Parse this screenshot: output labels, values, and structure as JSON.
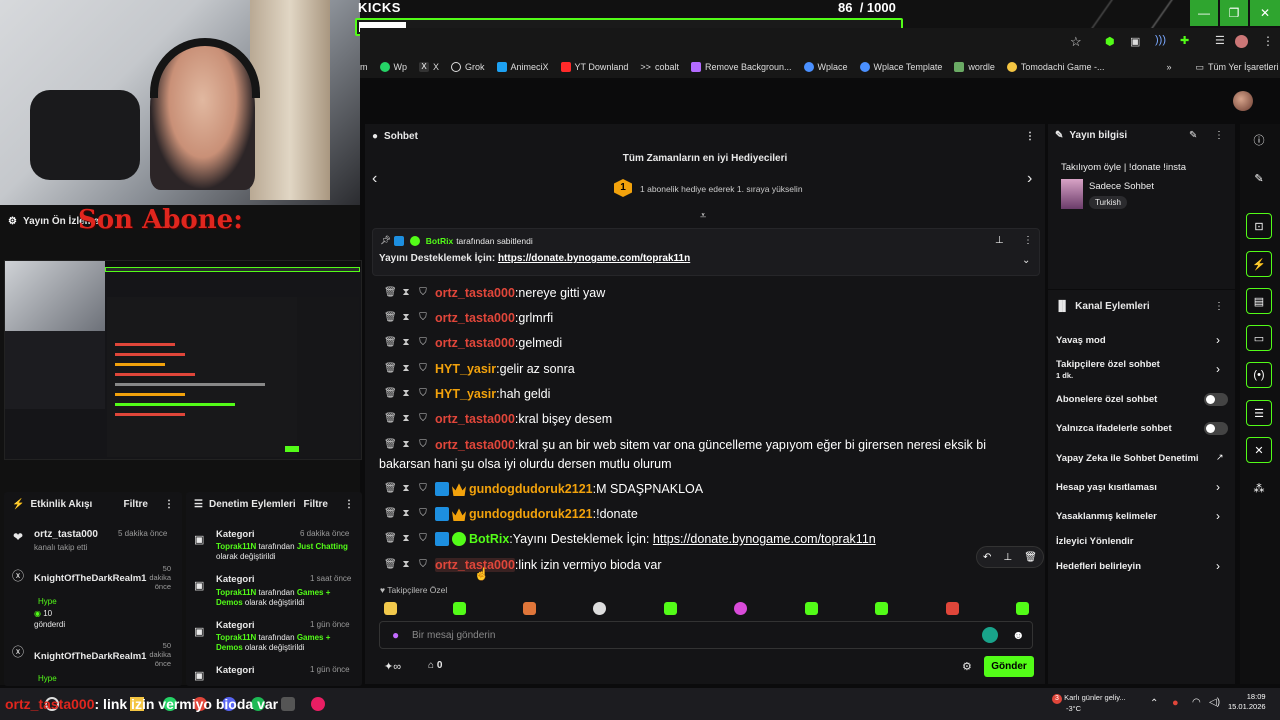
{
  "browser": {
    "goal_title": "KICKS",
    "goal_count": "86",
    "goal_total": "/ 1000",
    "goal_progress": 0.086,
    "bookmarks": [
      {
        "label": "Wp",
        "icon": "whatsapp-icon",
        "color": "#25d366"
      },
      {
        "label": "X",
        "icon": "x-icon",
        "color": "#ffffff"
      },
      {
        "label": "Grok",
        "icon": "grok-icon",
        "color": "#dddddd"
      },
      {
        "label": "AnimeciX",
        "icon": "animecix-icon",
        "color": "#1da1f2"
      },
      {
        "label": "YT Downland",
        "icon": "youtube-icon",
        "color": "#ff2a2a"
      },
      {
        "label": "cobalt",
        "icon": "cobalt-icon",
        "color": "#dddddd"
      },
      {
        "label": "Remove Backgroun...",
        "icon": "removebg-icon",
        "color": "#b36bff"
      },
      {
        "label": "Wplace",
        "icon": "wplace-icon",
        "color": "#4a90ff"
      },
      {
        "label": "Wplace Template",
        "icon": "wplace-template-icon",
        "color": "#4a90ff"
      },
      {
        "label": "wordle",
        "icon": "wordle-icon",
        "color": "#6aaa64"
      },
      {
        "label": "Tomodachi Game -...",
        "icon": "tomodachi-icon",
        "color": "#f4c542"
      }
    ],
    "all_bookmarks": "Tüm Yer İşaretleri"
  },
  "overlay": {
    "preview_title": "Yayın Ön İzleme",
    "son_abone": "Son Abone:",
    "activity": {
      "title": "Etkinlik Akışı",
      "filter": "Filtre",
      "items": [
        {
          "user": "ortz_tasta000",
          "detail": "kanalı takip etti",
          "time": "5 dakika önce"
        },
        {
          "user": "KnightOfTheDarkRealm1",
          "detail": "Hype",
          "amount": "10",
          "extra": "gönderdi",
          "time": "50 dakika önce"
        },
        {
          "user": "KnightOfTheDarkRealm1",
          "detail": "Hype",
          "time": "50 dakika önce"
        }
      ]
    },
    "moderation": {
      "title": "Denetim Eylemleri",
      "filter": "Filtre",
      "items": [
        {
          "label": "Kategori",
          "time": "6 dakika önce",
          "user": "Toprak11N",
          "mid": "tarafından",
          "value": "Just Chatting",
          "tail": "olarak değiştirildi"
        },
        {
          "label": "Kategori",
          "time": "1 saat önce",
          "user": "Toprak11N",
          "mid": "tarafından",
          "value": "Games + Demos",
          "tail": "olarak değiştirildi"
        },
        {
          "label": "Kategori",
          "time": "1 gün önce",
          "user": "Toprak11N",
          "mid": "tarafından",
          "value": "Games + Demos",
          "tail": "olarak değiştirildi"
        },
        {
          "label": "Kategori",
          "time": "1 gün önce"
        }
      ]
    }
  },
  "chat": {
    "title": "Sohbet",
    "gifters_title": "Tüm Zamanların en iyi Hediyecileri",
    "gifters_rank": "1",
    "gifters_text": "1 abonelik hediye ederek 1. sıraya yükselin",
    "pinned_by": "BotRix",
    "pinned_suffix": "tarafından sabitlendi",
    "pinned_text": "Yayını Desteklemek İçin:",
    "pinned_link": "https://donate.bynogame.com/toprak11n",
    "messages": [
      {
        "user": "ortz_tasta000",
        "text": "nereye gitti yaw",
        "color": "#e0463a"
      },
      {
        "user": "ortz_tasta000",
        "text": "grlmrfi",
        "color": "#e0463a"
      },
      {
        "user": "ortz_tasta000",
        "text": "gelmedi",
        "color": "#e0463a"
      },
      {
        "user": "HYT_yasir",
        "text": "gelir az sonra",
        "color": "#f2a20c"
      },
      {
        "user": "HYT_yasir",
        "text": "hah geldi",
        "color": "#f2a20c"
      },
      {
        "user": "ortz_tasta000",
        "text": "kral bişey desem",
        "color": "#e0463a"
      },
      {
        "user": "ortz_tasta000",
        "text": "kral şu an bir web sitem var ona güncelleme yapıyom eğer bi girersen neresi eksik bi",
        "text2": "bakarsan hani şu olsa iyi olurdu dersen mutlu olurum",
        "color": "#e0463a"
      },
      {
        "user": "gundogdudoruk2121",
        "text": "M SDAŞPNAKLOA",
        "color": "#f2a20c",
        "badges": true
      },
      {
        "user": "gundogdudoruk2121",
        "text": "!donate",
        "color": "#f2a20c",
        "badges": true
      },
      {
        "user": "BotRix",
        "text": "Yayını Desteklemek İçin:",
        "link": "https://donate.bynogame.com/toprak11n",
        "color": "#53fc18",
        "bot": true
      },
      {
        "user": "ortz_tasta000",
        "text": "link izin vermiyo bioda var",
        "color": "#e0463a",
        "hover": true
      }
    ],
    "followers_only": "Takipçilere Özel",
    "input_placeholder": "Bir mesaj gönderin",
    "points": "0",
    "send_label": "Gönder"
  },
  "stream_info": {
    "title": "Yayın bilgisi",
    "stream_title": "Takılıyom öyle | !donate !insta",
    "category": "Sadece Sohbet",
    "tag": "Turkish"
  },
  "channel_actions": {
    "title": "Kanal Eylemleri",
    "items": [
      {
        "label": "Yavaş mod",
        "type": "chevron"
      },
      {
        "label": "Takipçilere özel sohbet",
        "sub": "1 dk.",
        "type": "chevron"
      },
      {
        "label": "Abonelere özel sohbet",
        "type": "toggle"
      },
      {
        "label": "Yalnızca ifadelerle sohbet",
        "type": "toggle"
      },
      {
        "label": "Yapay Zeka ile Sohbet Denetimi",
        "type": "external"
      },
      {
        "label": "Hesap yaşı kısıtlaması",
        "type": "chevron"
      },
      {
        "label": "Yasaklanmış kelimeler",
        "type": "chevron"
      },
      {
        "label": "İzleyici Yönlendir",
        "type": "none"
      },
      {
        "label": "Hedefleri belirleyin",
        "type": "chevron"
      }
    ]
  },
  "taskbar": {
    "overlay_user": "ortz_tasta000",
    "overlay_text": ": link izin vermiyo bioda var",
    "weather_badge": "3",
    "weather_text": "Karlı günler geliy...",
    "weather_temp": "-3°C",
    "time": "18:09",
    "date": "15.01.2026"
  }
}
